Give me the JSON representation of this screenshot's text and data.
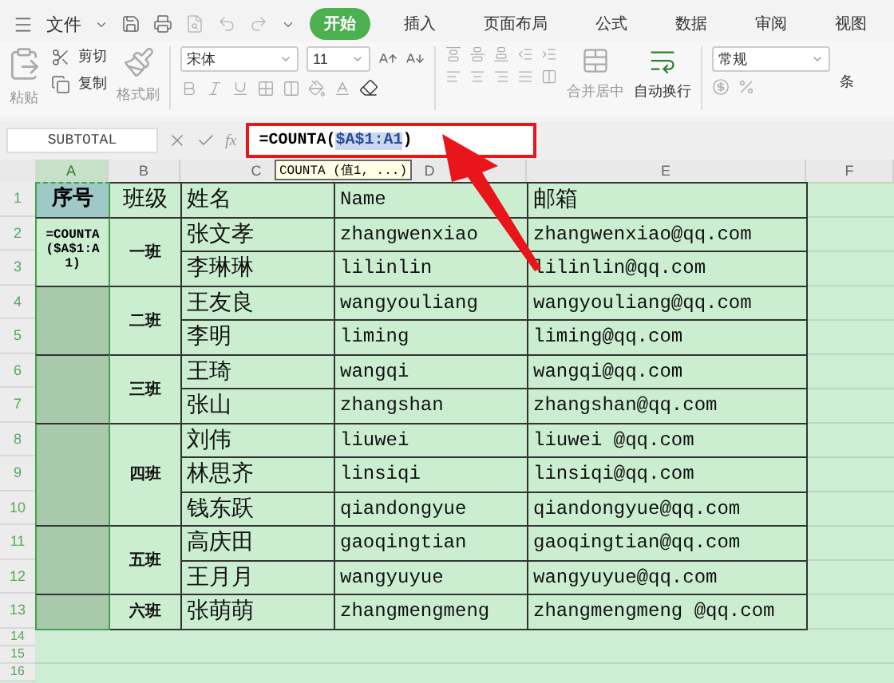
{
  "menu": {
    "file_label": "文件",
    "tabs": [
      {
        "label": "开始",
        "selected": true
      },
      {
        "label": "插入",
        "selected": false
      },
      {
        "label": "页面布局",
        "selected": false
      },
      {
        "label": "公式",
        "selected": false
      },
      {
        "label": "数据",
        "selected": false
      },
      {
        "label": "审阅",
        "selected": false
      },
      {
        "label": "视图",
        "selected": false
      }
    ]
  },
  "ribbon": {
    "paste": "粘贴",
    "cut": "剪切",
    "copy": "复制",
    "format_painter": "格式刷",
    "font": "宋体",
    "font_size": "11",
    "merge": "合并居中",
    "wrap": "自动换行",
    "number_format": "常规",
    "cut_off_label": "条"
  },
  "formula_bar": {
    "name_box": "SUBTOTAL",
    "fx": "fx",
    "parts": [
      {
        "text": "=COUNTA(",
        "kind": "plain"
      },
      {
        "text": "$A$1:A1",
        "kind": "reference"
      },
      {
        "text": ")",
        "kind": "plain"
      }
    ],
    "tooltip": "COUNTA (值1, ...)"
  },
  "sheet": {
    "columns": [
      {
        "label": "A",
        "selected": true
      },
      {
        "label": "B",
        "selected": false
      },
      {
        "label": "C",
        "selected": false
      },
      {
        "label": "D",
        "selected": false
      },
      {
        "label": "E",
        "selected": false
      },
      {
        "label": "F",
        "selected": false
      }
    ],
    "row_numbers": [
      "1",
      "2",
      "3",
      "4",
      "5",
      "6",
      "7",
      "8",
      "9",
      "10",
      "11",
      "12",
      "13",
      "14",
      "15",
      "16"
    ],
    "header": [
      {
        "text": "序号",
        "selected": true
      },
      {
        "text": "班级",
        "selected": false
      },
      {
        "text": "姓名",
        "selected": false
      },
      {
        "text": "Name",
        "selected": false
      },
      {
        "text": "邮箱",
        "selected": false
      }
    ],
    "groups": [
      {
        "class": "一班",
        "seq": {
          "text": "=COUNTA($A$1:A1)",
          "selected": false
        },
        "students": [
          {
            "name": "张文孝",
            "pinyin": "zhangwenxiao",
            "email": "zhangwenxiao@qq.com"
          },
          {
            "name": "李琳琳",
            "pinyin": "lilinlin",
            "email": "lilinlin@qq.com"
          }
        ]
      },
      {
        "class": "二班",
        "seq": {
          "selected": true
        },
        "students": [
          {
            "name": "王友良",
            "pinyin": "wangyouliang",
            "email": "wangyouliang@qq.com"
          },
          {
            "name": "李明",
            "pinyin": "liming",
            "email": "liming@qq.com"
          }
        ]
      },
      {
        "class": "三班",
        "seq": {
          "selected": true
        },
        "students": [
          {
            "name": "王琦",
            "pinyin": "wangqi",
            "email": "wangqi@qq.com"
          },
          {
            "name": "张山",
            "pinyin": "zhangshan",
            "email": "zhangshan@qq.com"
          }
        ]
      },
      {
        "class": "四班",
        "seq": {
          "selected": true
        },
        "students": [
          {
            "name": "刘伟",
            "pinyin": "liuwei",
            "email": "liuwei @qq.com"
          },
          {
            "name": "林思齐",
            "pinyin": "linsiqi",
            "email": "linsiqi@qq.com"
          },
          {
            "name": "钱东跃",
            "pinyin": "qiandongyue",
            "email": "qiandongyue@qq.com"
          }
        ]
      },
      {
        "class": "五班",
        "seq": {
          "selected": true
        },
        "students": [
          {
            "name": "高庆田",
            "pinyin": "gaoqingtian",
            "email": "gaoqingtian@qq.com"
          },
          {
            "name": "王月月",
            "pinyin": "wangyuyue",
            "email": "wangyuyue@qq.com"
          }
        ]
      },
      {
        "class": "六班",
        "seq": {
          "selected": true
        },
        "students": [
          {
            "name": "张萌萌",
            "pinyin": "zhangmengmeng",
            "email": "zhangmengmeng @qq.com"
          }
        ]
      }
    ]
  }
}
